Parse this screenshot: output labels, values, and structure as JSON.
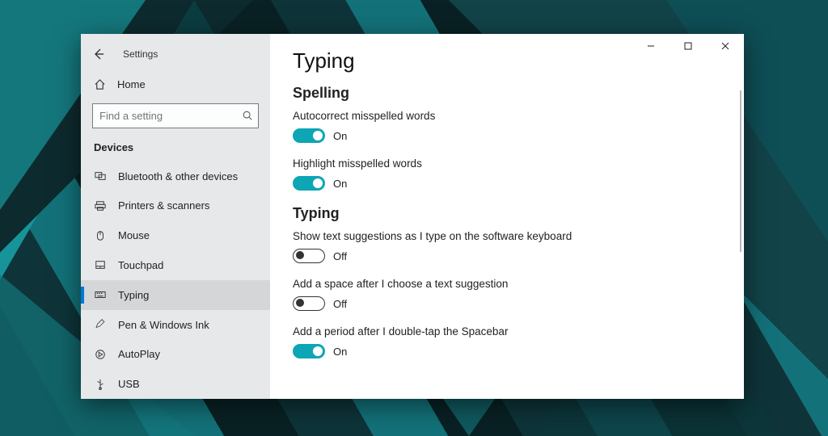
{
  "app_title": "Settings",
  "home_label": "Home",
  "search": {
    "placeholder": "Find a setting"
  },
  "section_header": "Devices",
  "nav_items": [
    {
      "label": "Bluetooth & other devices"
    },
    {
      "label": "Printers & scanners"
    },
    {
      "label": "Mouse"
    },
    {
      "label": "Touchpad"
    },
    {
      "label": "Typing"
    },
    {
      "label": "Pen & Windows Ink"
    },
    {
      "label": "AutoPlay"
    },
    {
      "label": "USB"
    }
  ],
  "page_title": "Typing",
  "groups": {
    "spelling": {
      "title": "Spelling",
      "settings": [
        {
          "label": "Autocorrect misspelled words",
          "state": "On",
          "on": true
        },
        {
          "label": "Highlight misspelled words",
          "state": "On",
          "on": true
        }
      ]
    },
    "typing": {
      "title": "Typing",
      "settings": [
        {
          "label": "Show text suggestions as I type on the software keyboard",
          "state": "Off",
          "on": false
        },
        {
          "label": "Add a space after I choose a text suggestion",
          "state": "Off",
          "on": false
        },
        {
          "label": "Add a period after I double-tap the Spacebar",
          "state": "On",
          "on": true
        }
      ]
    }
  },
  "colors": {
    "accent": "#0078d7",
    "toggle_on": "#0ea5b5"
  }
}
